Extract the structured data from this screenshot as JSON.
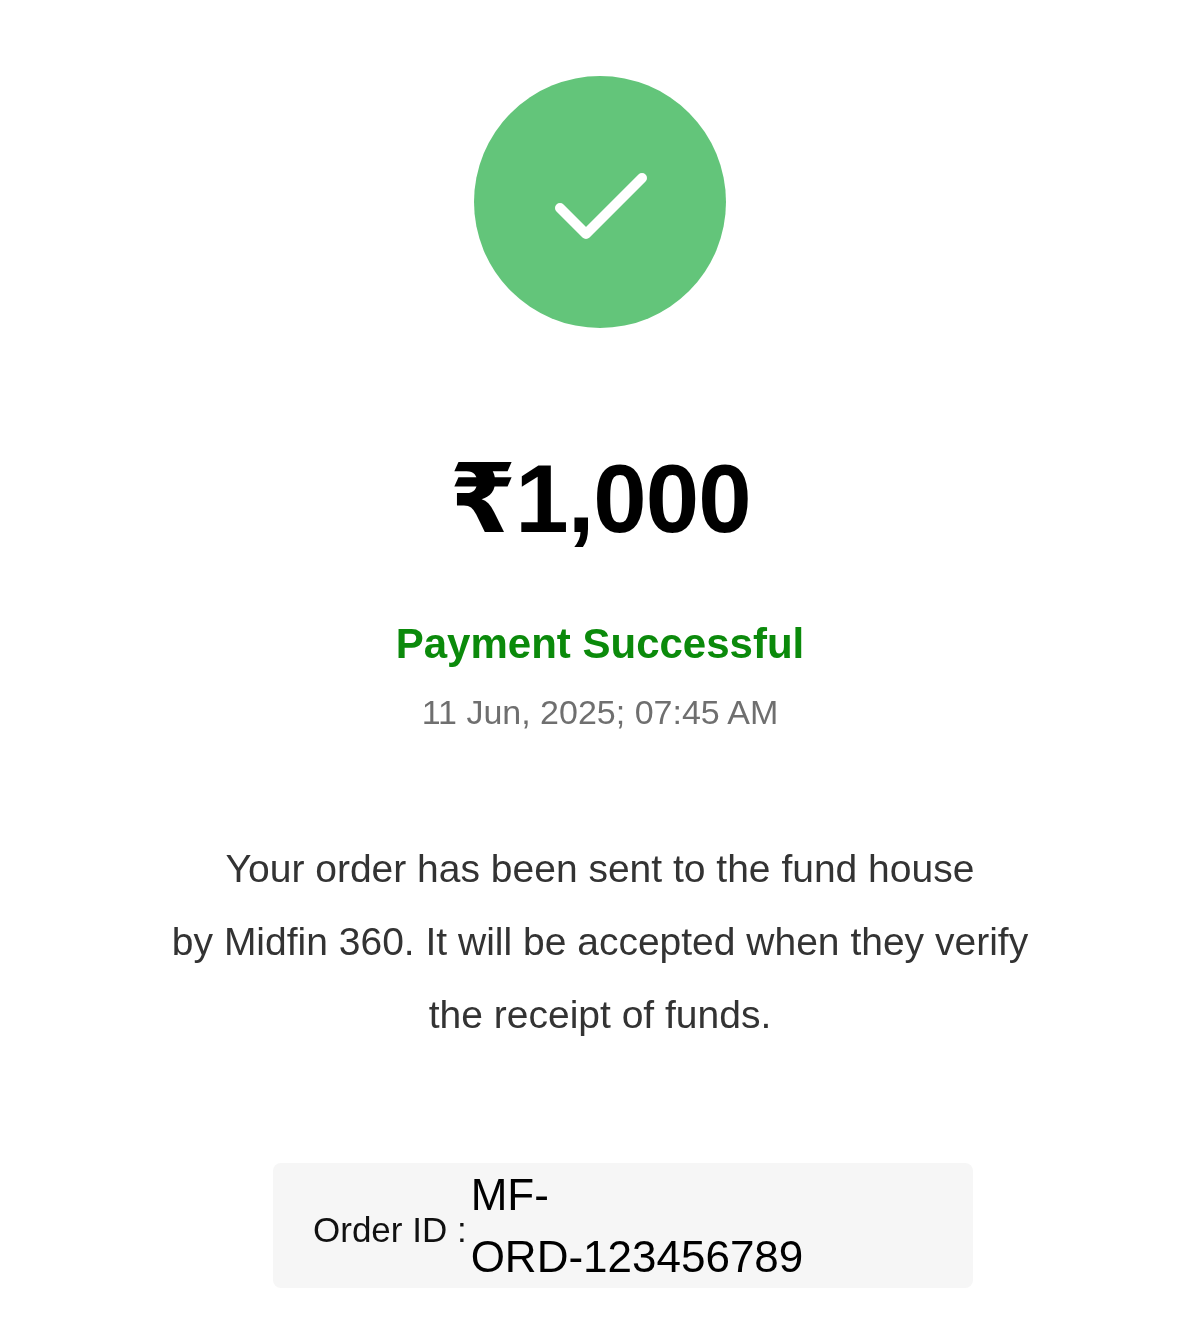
{
  "status_icon": {
    "kind": "success"
  },
  "amount": "₹1,000",
  "status_text": "Payment Successful",
  "timestamp": "11 Jun, 2025; 07:45 AM",
  "message": "Your order has been sent to the fund house\nby Midfin 360. It will be accepted when they verify\nthe receipt of funds.",
  "order": {
    "label": "Order ID :",
    "value": "MF-\nORD-123456789"
  }
}
